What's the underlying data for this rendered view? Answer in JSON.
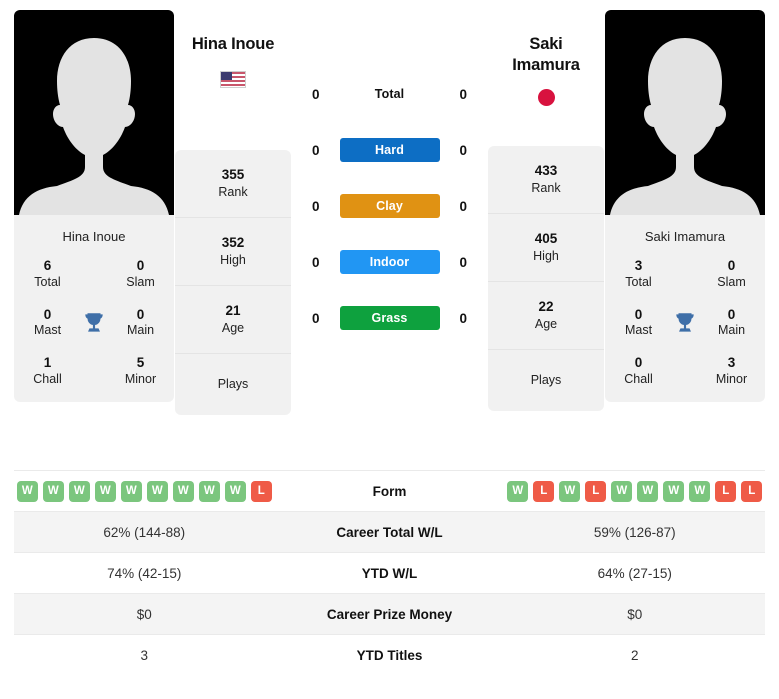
{
  "players": {
    "left": {
      "name": "Hina Inoue",
      "country_icon": "flag-us-icon",
      "photo_alt": "Hina Inoue",
      "titles_name": "Hina Inoue",
      "titles": {
        "total_val": "6",
        "total_lbl": "Total",
        "slam_val": "0",
        "slam_lbl": "Slam",
        "mast_val": "0",
        "mast_lbl": "Mast",
        "main_val": "0",
        "main_lbl": "Main",
        "chall_val": "1",
        "chall_lbl": "Chall",
        "minor_val": "5",
        "minor_lbl": "Minor"
      },
      "stats": {
        "rank_val": "355",
        "rank_lbl": "Rank",
        "high_val": "352",
        "high_lbl": "High",
        "age_val": "21",
        "age_lbl": "Age",
        "plays_lbl": "Plays",
        "plays_val": ""
      },
      "h2h": {
        "total": "0",
        "hard": "0",
        "clay": "0",
        "indoor": "0",
        "grass": "0"
      },
      "form": [
        "W",
        "W",
        "W",
        "W",
        "W",
        "W",
        "W",
        "W",
        "W",
        "L"
      ],
      "career_total_wl": "62% (144-88)",
      "ytd_wl": "74% (42-15)",
      "career_prize_money": "$0",
      "ytd_titles": "3"
    },
    "right": {
      "name": "Saki Imamura",
      "name_line1": "Saki",
      "name_line2": "Imamura",
      "country_icon": "flag-jp-icon",
      "photo_alt": "Saki Imamura",
      "titles_name": "Saki Imamura",
      "titles": {
        "total_val": "3",
        "total_lbl": "Total",
        "slam_val": "0",
        "slam_lbl": "Slam",
        "mast_val": "0",
        "mast_lbl": "Mast",
        "main_val": "0",
        "main_lbl": "Main",
        "chall_val": "0",
        "chall_lbl": "Chall",
        "minor_val": "3",
        "minor_lbl": "Minor"
      },
      "stats": {
        "rank_val": "433",
        "rank_lbl": "Rank",
        "high_val": "405",
        "high_lbl": "High",
        "age_val": "22",
        "age_lbl": "Age",
        "plays_lbl": "Plays",
        "plays_val": ""
      },
      "h2h": {
        "total": "0",
        "hard": "0",
        "clay": "0",
        "indoor": "0",
        "grass": "0"
      },
      "form": [
        "W",
        "L",
        "W",
        "L",
        "W",
        "W",
        "W",
        "W",
        "L",
        "L"
      ],
      "career_total_wl": "59% (126-87)",
      "ytd_wl": "64% (27-15)",
      "career_prize_money": "$0",
      "ytd_titles": "2"
    }
  },
  "surfaces": {
    "total_label": "Total",
    "hard_label": "Hard",
    "clay_label": "Clay",
    "indoor_label": "Indoor",
    "grass_label": "Grass"
  },
  "table_labels": {
    "form": "Form",
    "career_total_wl": "Career Total W/L",
    "ytd_wl": "YTD W/L",
    "career_prize_money": "Career Prize Money",
    "ytd_titles": "YTD Titles"
  },
  "colors": {
    "hard": "#0d6ec4",
    "clay": "#e09213",
    "indoor": "#2196f3",
    "grass": "#0ea13e",
    "win": "#7bc67e",
    "loss": "#ef5b47",
    "trophy": "#3f6fa8",
    "card_bg": "#f1f1f1",
    "row_alt": "#f4f4f4",
    "japan_red": "#d8123f"
  }
}
